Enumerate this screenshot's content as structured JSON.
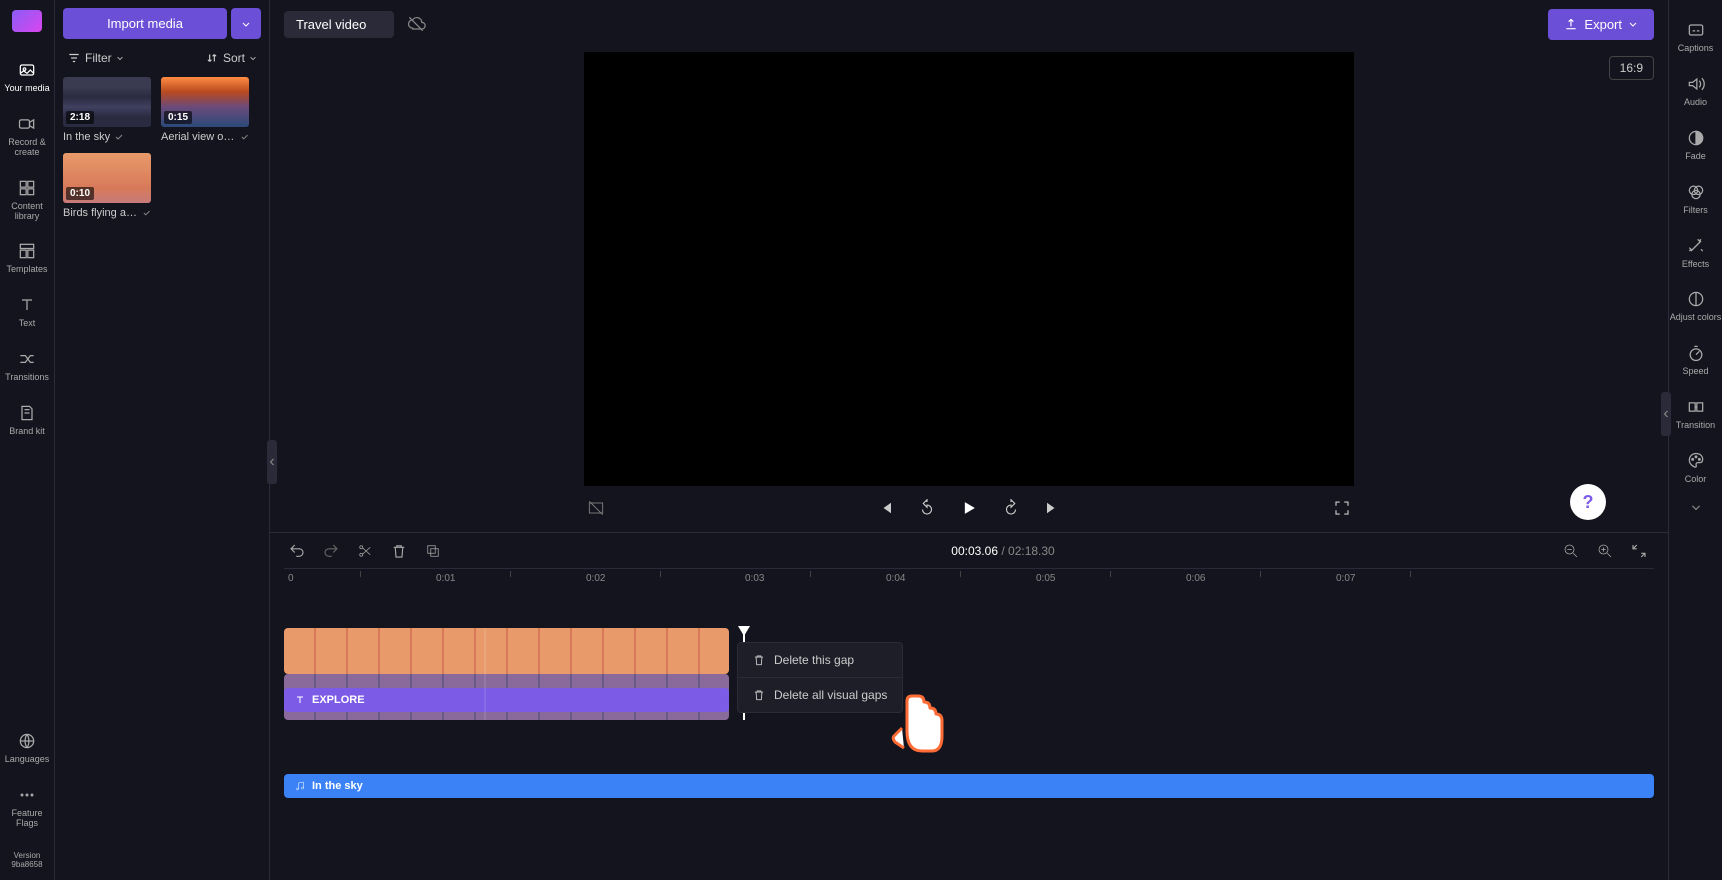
{
  "topbar": {
    "title": "Travel video",
    "export_label": "Export",
    "aspect_ratio": "16:9"
  },
  "left_rail": {
    "items": [
      {
        "id": "your-media",
        "label": "Your media"
      },
      {
        "id": "record-create",
        "label": "Record & create"
      },
      {
        "id": "content-library",
        "label": "Content library"
      },
      {
        "id": "templates",
        "label": "Templates"
      },
      {
        "id": "text",
        "label": "Text"
      },
      {
        "id": "transitions",
        "label": "Transitions"
      },
      {
        "id": "brand-kit",
        "label": "Brand kit"
      }
    ],
    "bottom": [
      {
        "id": "languages",
        "label": "Languages"
      },
      {
        "id": "feature-flags",
        "label": "Feature Flags"
      },
      {
        "id": "version",
        "label": "Version 9ba8658"
      }
    ]
  },
  "media_panel": {
    "import_label": "Import media",
    "filter_label": "Filter",
    "sort_label": "Sort",
    "items": [
      {
        "name": "In the sky",
        "duration": "2:18"
      },
      {
        "name": "Aerial view of …",
        "duration": "0:15"
      },
      {
        "name": "Birds flying ab…",
        "duration": "0:10"
      }
    ]
  },
  "timeline_toolbar": {
    "current_time": "00:03.06",
    "duration": "02:18.30"
  },
  "ruler_ticks": [
    "0",
    "0:01",
    "0:02",
    "0:03",
    "0:04",
    "0:05",
    "0:06",
    "0:07"
  ],
  "clips": {
    "text_label": "EXPLORE",
    "audio_label": "In the sky"
  },
  "context_menu": {
    "delete_gap": "Delete this gap",
    "delete_all_gaps": "Delete all visual gaps"
  },
  "right_rail": {
    "items": [
      {
        "id": "captions",
        "label": "Captions"
      },
      {
        "id": "audio",
        "label": "Audio"
      },
      {
        "id": "fade",
        "label": "Fade"
      },
      {
        "id": "filters",
        "label": "Filters"
      },
      {
        "id": "effects",
        "label": "Effects"
      },
      {
        "id": "adjust-colors",
        "label": "Adjust colors"
      },
      {
        "id": "speed",
        "label": "Speed"
      },
      {
        "id": "transition",
        "label": "Transition"
      },
      {
        "id": "color",
        "label": "Color"
      }
    ]
  },
  "help": {
    "label": "?"
  }
}
